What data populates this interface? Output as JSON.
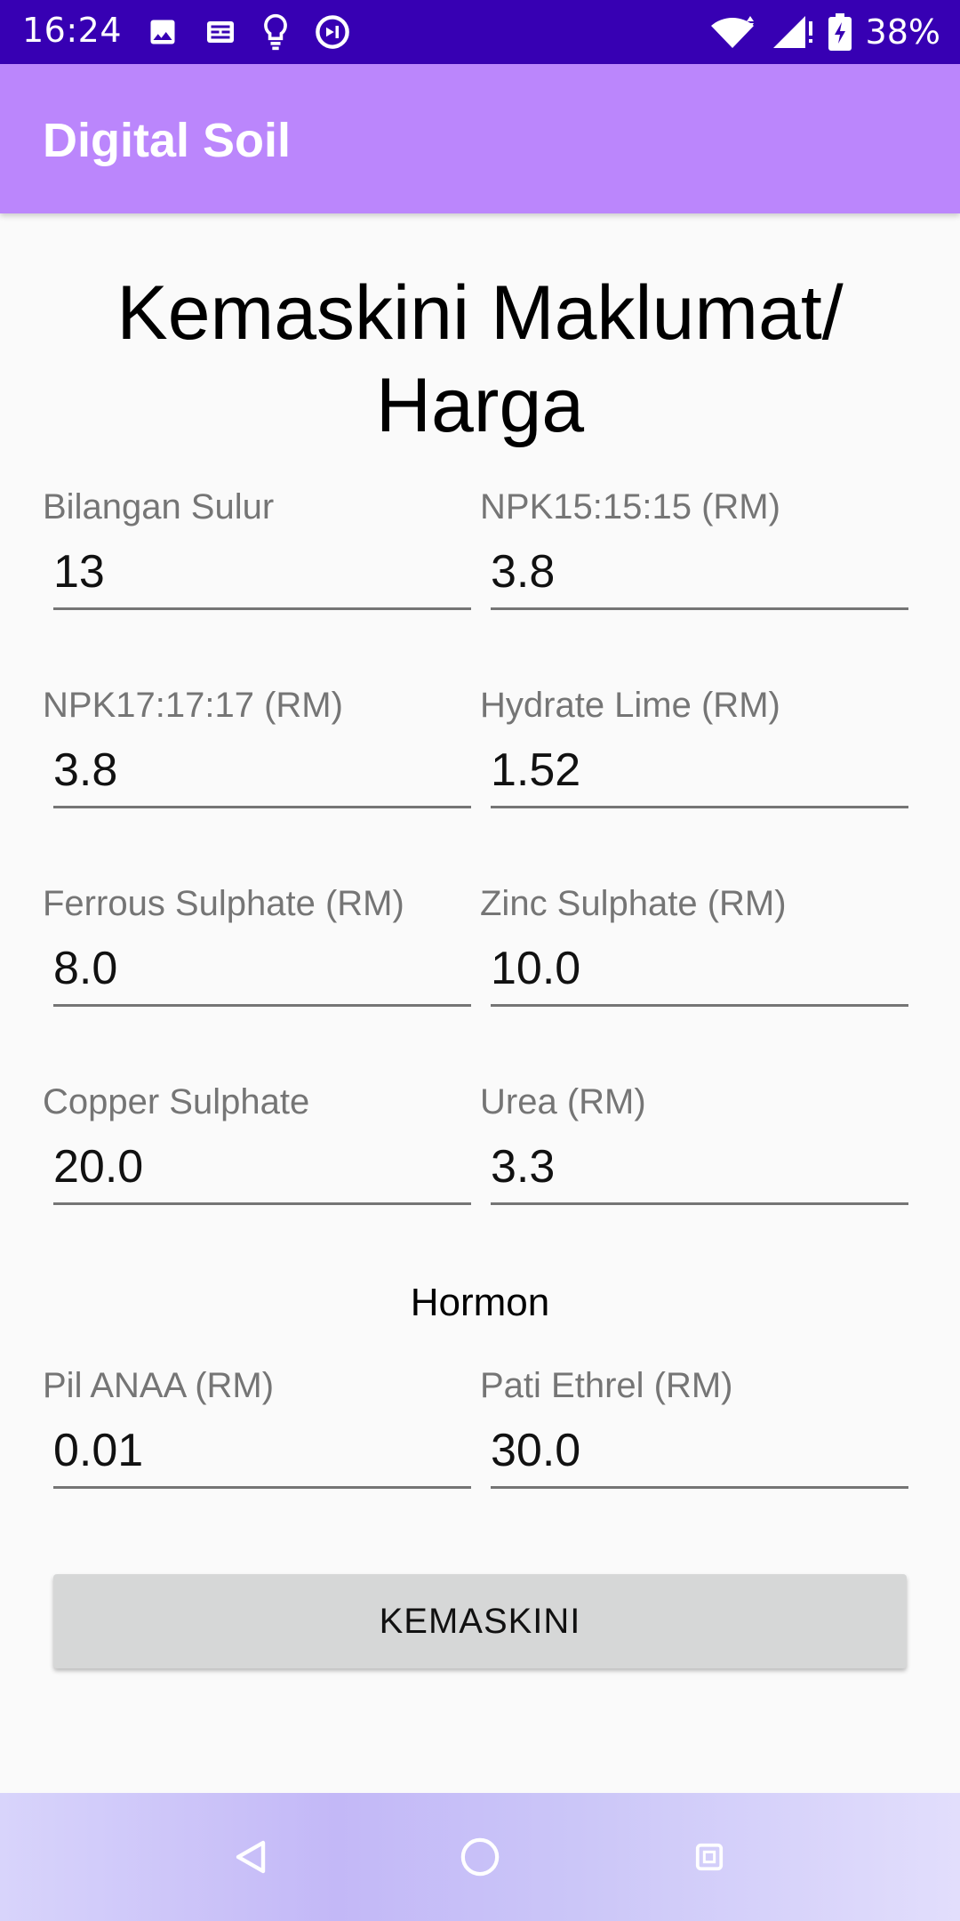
{
  "status_bar": {
    "time": "16:24",
    "battery": "38%",
    "icons": [
      "image-icon",
      "news-icon",
      "lightbulb-icon",
      "sync-icon",
      "wifi-icon",
      "signal-icon",
      "battery-charging-icon"
    ]
  },
  "app_bar": {
    "title": "Digital Soil"
  },
  "page": {
    "heading": "Kemaskini Maklumat/ Harga",
    "fields": {
      "bilangan_sulur": {
        "label": "Bilangan Sulur",
        "value": "13"
      },
      "npk151515": {
        "label": "NPK15:15:15 (RM)",
        "value": "3.8"
      },
      "npk171717": {
        "label": "NPK17:17:17 (RM)",
        "value": "3.8"
      },
      "hydrate_lime": {
        "label": "Hydrate Lime (RM)",
        "value": "1.52"
      },
      "ferrous_sulphate": {
        "label": "Ferrous Sulphate (RM)",
        "value": "8.0"
      },
      "zinc_sulphate": {
        "label": "Zinc Sulphate (RM)",
        "value": "10.0"
      },
      "copper_sulphate": {
        "label": "Copper Sulphate",
        "value": "20.0"
      },
      "urea": {
        "label": "Urea (RM)",
        "value": "3.3"
      },
      "pil_anaa": {
        "label": "Pil ANAA (RM)",
        "value": "0.01"
      },
      "pati_ethrel": {
        "label": "Pati Ethrel (RM)",
        "value": "30.0"
      }
    },
    "hormone_section_label": "Hormon",
    "update_button_label": "KEMASKINI"
  },
  "nav_bar": {
    "buttons": [
      "back-icon",
      "home-icon",
      "recents-icon"
    ]
  },
  "colors": {
    "status_bar": "#3700b3",
    "app_bar": "#bb86fc",
    "button": "#d6d7d7",
    "label": "#757575"
  }
}
